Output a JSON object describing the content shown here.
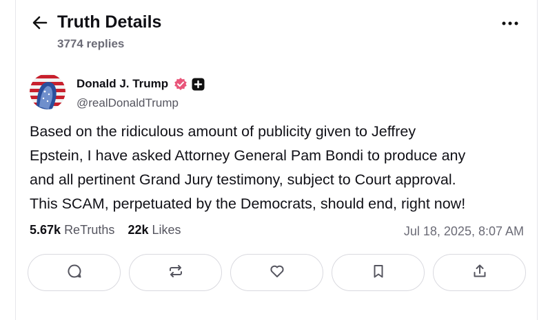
{
  "header": {
    "title": "Truth Details",
    "replies": "3774 replies",
    "back_icon": "arrow-left-icon",
    "more_icon": "more-horizontal-icon"
  },
  "post": {
    "author_name": "Donald J. Trump",
    "author_handle": "@realDonaldTrump",
    "verified_icon": "verified-badge-icon",
    "verified_color": "#e9567a",
    "plus_icon": "plus-square-icon",
    "body_lines": [
      "Based on the ridiculous amount of publicity given to Jeffrey",
      "Epstein, I have asked Attorney General Pam Bondi to produce any",
      "and all pertinent Grand Jury testimony, subject to Court approval.",
      "This SCAM, perpetuated by the Democrats, should end, right now!"
    ],
    "retruths_count": "5.67k",
    "retruths_label": "ReTruths",
    "likes_count": "22k",
    "likes_label": "Likes",
    "timestamp": "Jul 18, 2025, 8:07 AM"
  },
  "actions": [
    {
      "icon": "reply-icon"
    },
    {
      "icon": "retruth-icon"
    },
    {
      "icon": "like-heart-icon"
    },
    {
      "icon": "bookmark-icon"
    },
    {
      "icon": "share-icon"
    }
  ]
}
